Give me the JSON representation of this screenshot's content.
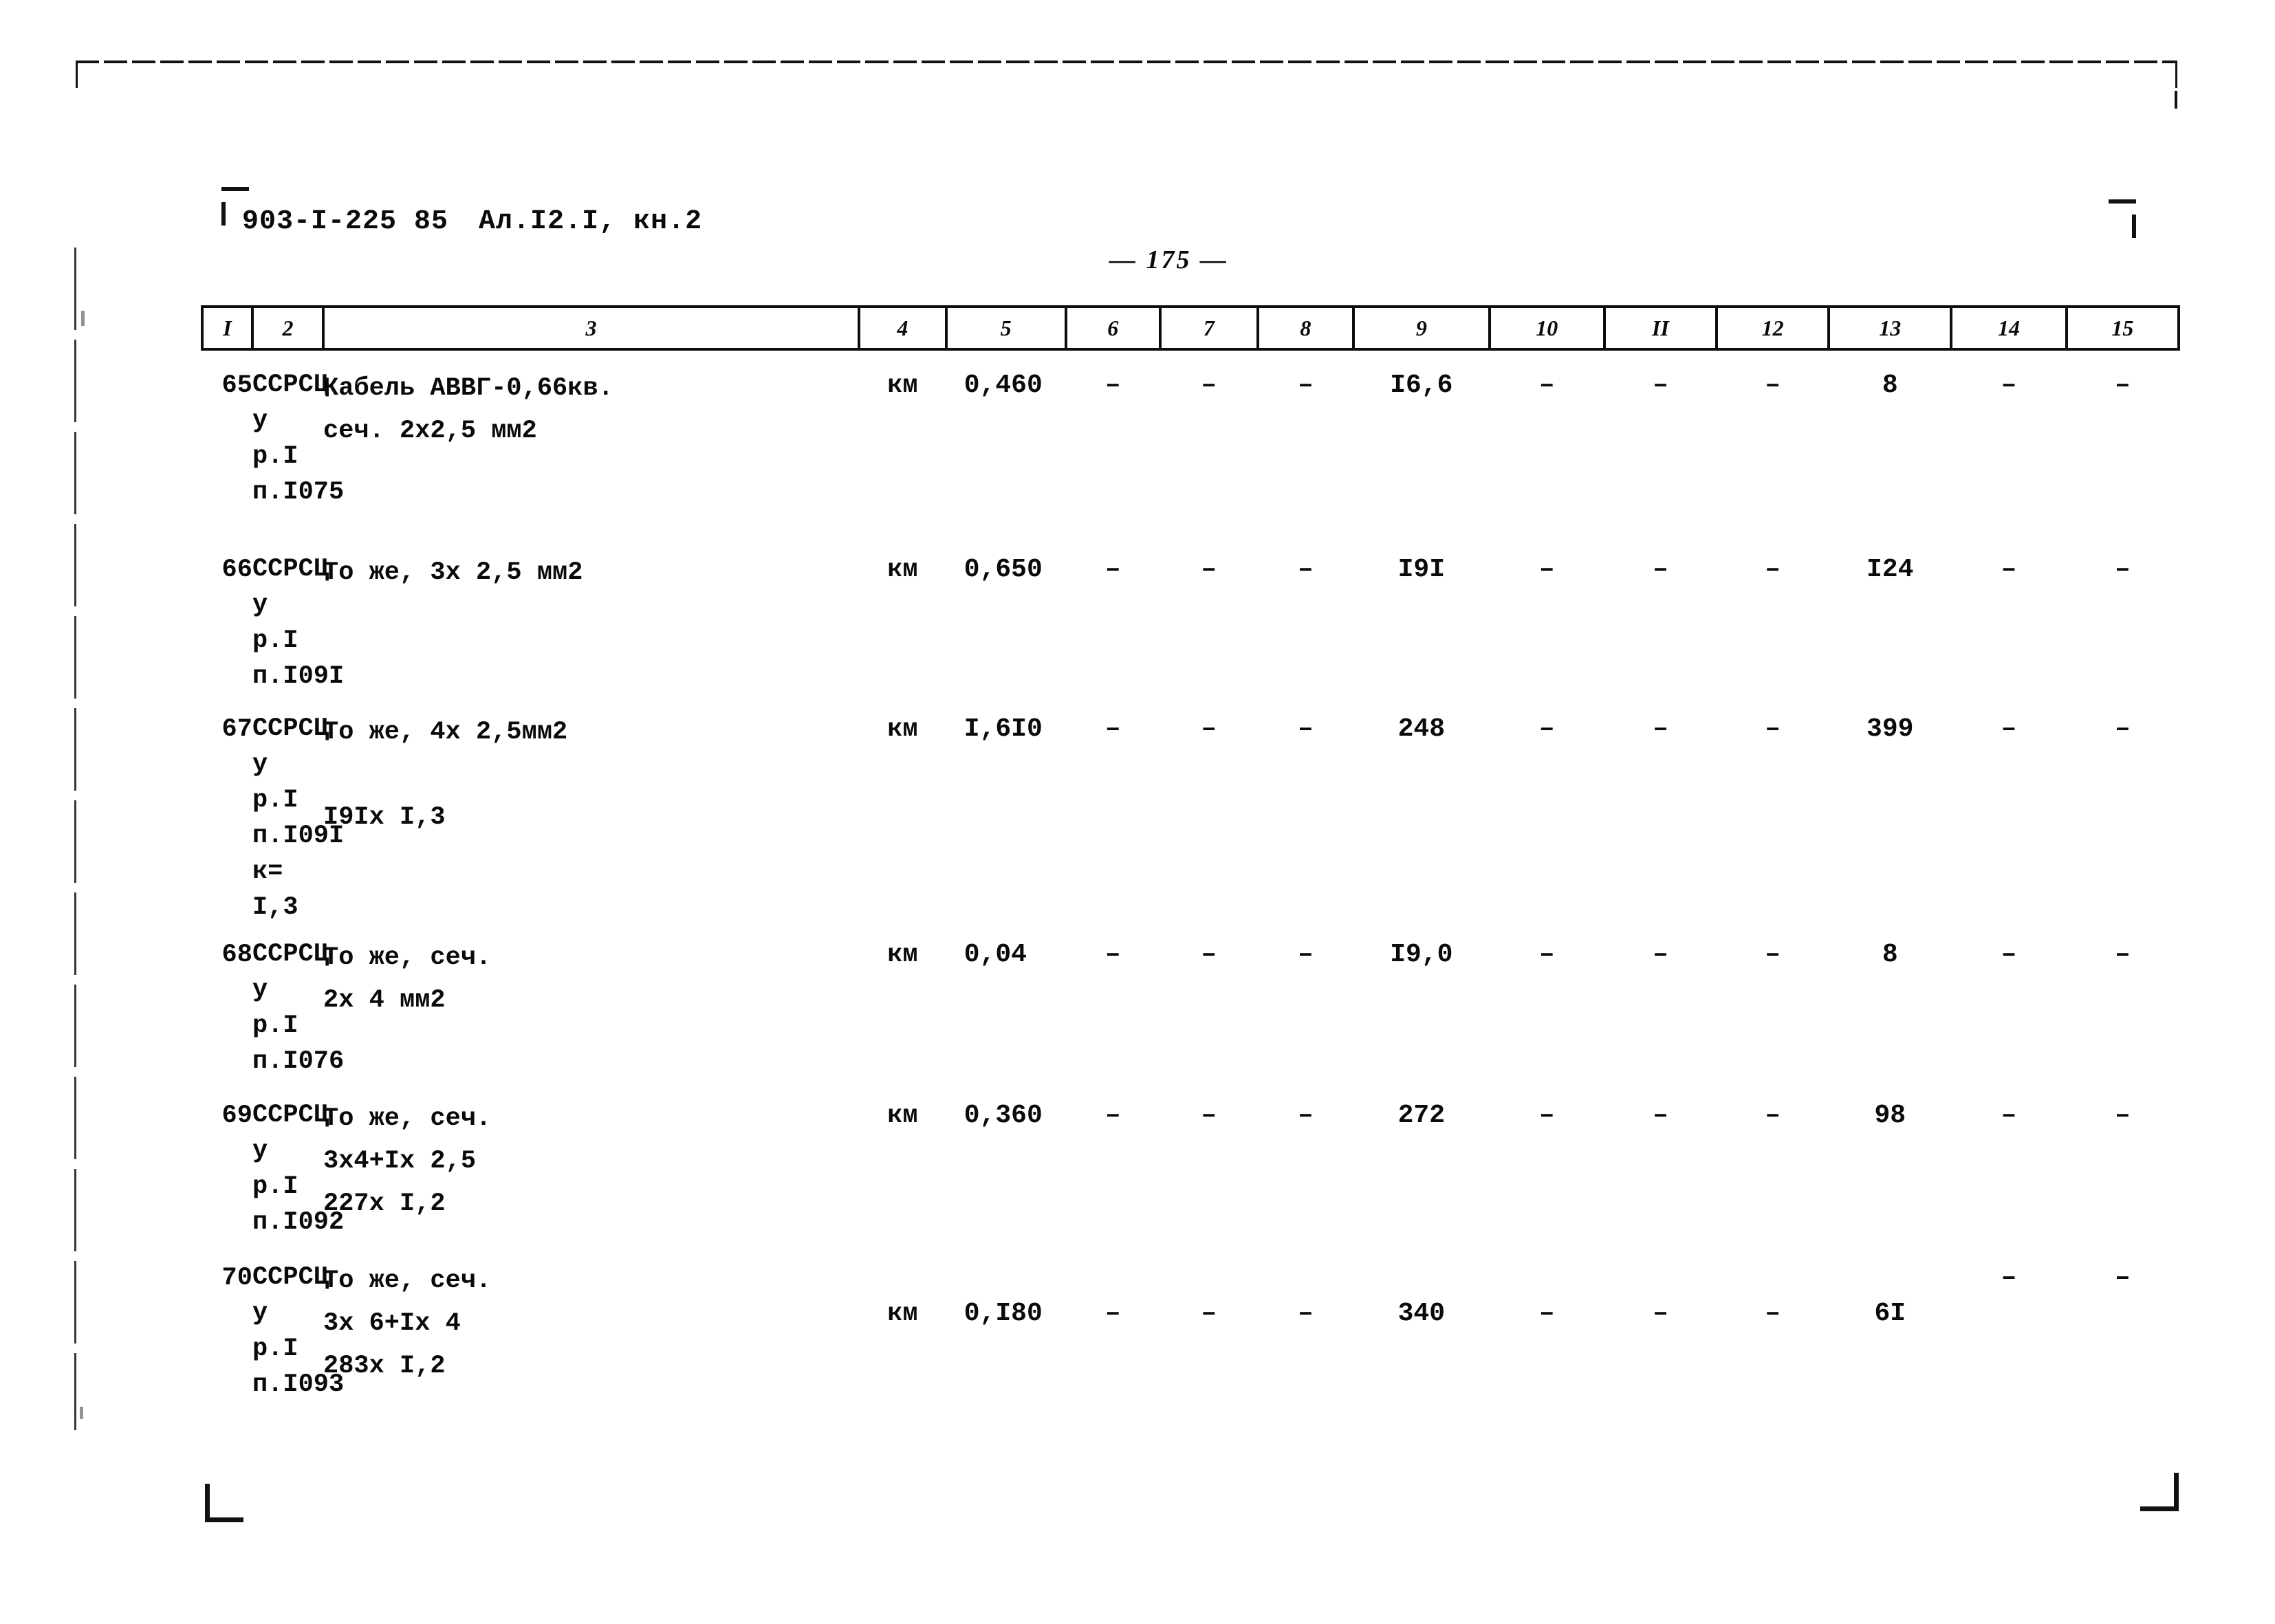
{
  "document": {
    "code": "903-I-225 85",
    "album": "Ал.I2.I, кн.2",
    "page_label": "— 175 —"
  },
  "table": {
    "column_headers": [
      "I",
      "2",
      "3",
      "4",
      "5",
      "6",
      "7",
      "8",
      "9",
      "10",
      "II",
      "12",
      "13",
      "14",
      "15"
    ],
    "rows": [
      {
        "num": "65",
        "code": "ССРСЦ\nу\nр.I\nп.I075",
        "description": "Кабель АВВГ-0,66кв.\nсеч. 2х2,5 мм2",
        "unit": "км",
        "c5": "0,460",
        "c6": "–",
        "c7": "–",
        "c8": "–",
        "c9": "I6,6",
        "c10": "–",
        "c11": "–",
        "c12": "–",
        "c13": "8",
        "c14": "–",
        "c15": "–"
      },
      {
        "num": "66",
        "code": "ССРСЦ\nу\nр.I\nп.I09I",
        "description": "То же, 3х 2,5 мм2",
        "unit": "км",
        "c5": "0,650",
        "c6": "–",
        "c7": "–",
        "c8": "–",
        "c9": "I9I",
        "c10": "–",
        "c11": "–",
        "c12": "–",
        "c13": "I24",
        "c14": "–",
        "c15": "–"
      },
      {
        "num": "67",
        "code": "ССРСЦ\nу\nр.I\nп.I09I\nк=\nI,3",
        "description": "То же, 4х 2,5мм2\n\nI9Iх I,3",
        "unit": "км",
        "c5": "I,6I0",
        "c6": "–",
        "c7": "–",
        "c8": "–",
        "c9": "248",
        "c10": "–",
        "c11": "–",
        "c12": "–",
        "c13": "399",
        "c14": "–",
        "c15": "–"
      },
      {
        "num": "68",
        "code": "ССРСЦ\nу\nр.I\nп.I076",
        "description": "То же, сеч.\n   2х 4 мм2",
        "unit": "км",
        "c5": "0,04",
        "c6": "–",
        "c7": "–",
        "c8": "–",
        "c9": "I9,0",
        "c10": "–",
        "c11": "–",
        "c12": "–",
        "c13": "8",
        "c14": "–",
        "c15": "–"
      },
      {
        "num": "69",
        "code": "ССРСЦ\nу\nр.I\nп.I092",
        "description": "То же, сеч.\n3х4+Iх 2,5\n   227х I,2",
        "unit": "км",
        "c5": "0,360",
        "c6": "–",
        "c7": "–",
        "c8": "–",
        "c9": "272",
        "c10": "–",
        "c11": "–",
        "c12": "–",
        "c13": "98",
        "c14": "–",
        "c15": "–"
      },
      {
        "num": "70",
        "code": "ССРСЦ\nу\nр.I\nп.I093",
        "description": "То же, сеч.\n3х 6+Iх 4\n   283х I,2",
        "unit": "км",
        "c5": "0,I80",
        "c6": "–",
        "c7": "–",
        "c8": "–",
        "c9": "340",
        "c10": "–",
        "c11": "–",
        "c12": "–",
        "c13": "6I",
        "c14": "–",
        "c15": "–"
      }
    ]
  }
}
